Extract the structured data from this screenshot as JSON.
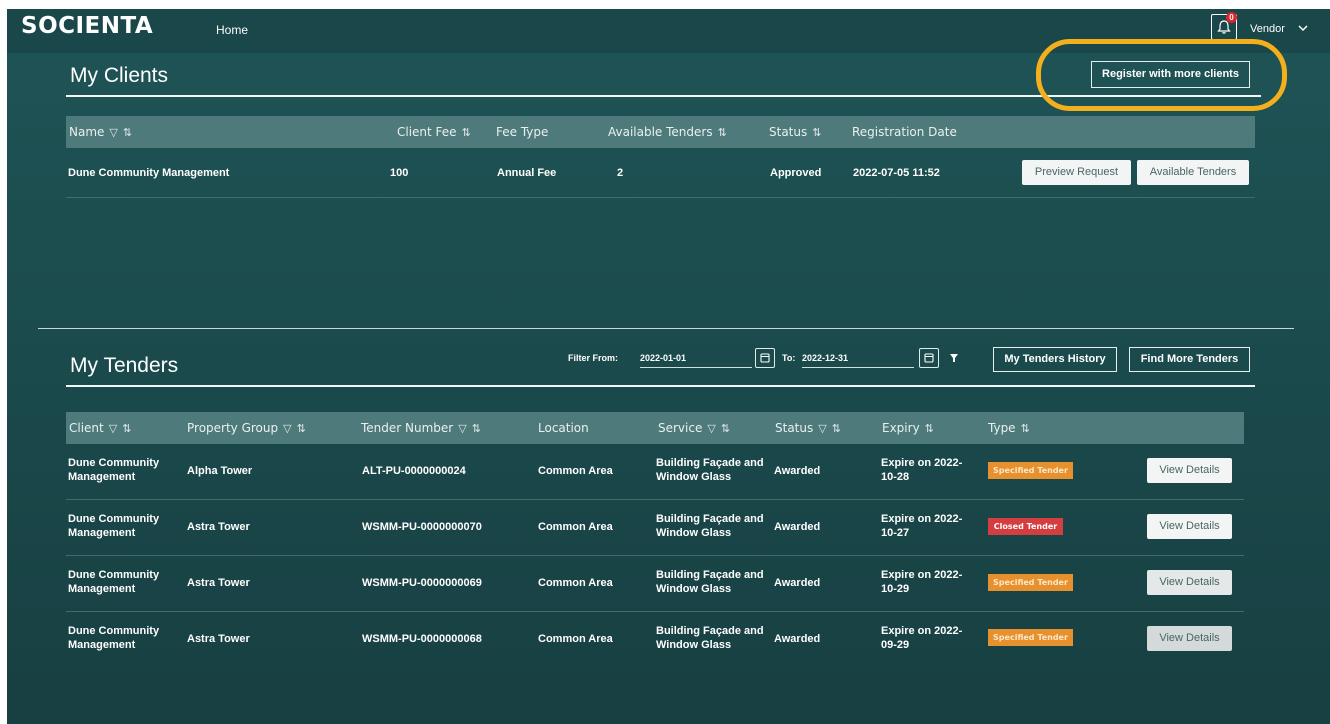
{
  "header": {
    "logo": "SOCIENTA",
    "nav_home": "Home",
    "notification_count": "0",
    "user_label": "Vendor"
  },
  "clients": {
    "title": "My Clients",
    "register_button": "Register with more clients",
    "columns": [
      "Name",
      "Client Fee",
      "Fee Type",
      "Available Tenders",
      "Status",
      "Registration Date"
    ],
    "rows": [
      {
        "name": "Dune Community Management",
        "fee": "100",
        "fee_type": "Annual Fee",
        "available_tenders": "2",
        "status": "Approved",
        "registration_date": "2022-07-05 11:52",
        "preview_button": "Preview Request",
        "tenders_button": "Available Tenders"
      }
    ]
  },
  "tenders": {
    "title": "My Tenders",
    "filter_from_label": "Filter From:",
    "filter_from_value": "2022-01-01",
    "filter_to_label": "To:",
    "filter_to_value": "2022-12-31",
    "history_button": "My Tenders History",
    "find_button": "Find More Tenders",
    "columns": [
      "Client",
      "Property Group",
      "Tender Number",
      "Location",
      "Service",
      "Status",
      "Expiry",
      "Type"
    ],
    "rows": [
      {
        "client_1": "Dune Community",
        "client_2": "Management",
        "property_group": "Alpha Tower",
        "tender_number": "ALT-PU-0000000024",
        "location": "Common Area",
        "service_1": "Building Façade and",
        "service_2": "Window Glass",
        "status": "Awarded",
        "expiry_1": "Expire on 2022-",
        "expiry_2": "10-28",
        "type": "Specified Tender",
        "type_kind": "specified",
        "action": "View Details"
      },
      {
        "client_1": "Dune Community",
        "client_2": "Management",
        "property_group": "Astra Tower",
        "tender_number": "WSMM-PU-0000000070",
        "location": "Common Area",
        "service_1": "Building Façade and",
        "service_2": "Window Glass",
        "status": "Awarded",
        "expiry_1": "Expire on 2022-",
        "expiry_2": "10-27",
        "type": "Closed Tender",
        "type_kind": "closed",
        "action": "View Details"
      },
      {
        "client_1": "Dune Community",
        "client_2": "Management",
        "property_group": "Astra Tower",
        "tender_number": "WSMM-PU-0000000069",
        "location": "Common Area",
        "service_1": "Building Façade and",
        "service_2": "Window Glass",
        "status": "Awarded",
        "expiry_1": "Expire on 2022-",
        "expiry_2": "10-29",
        "type": "Specified Tender",
        "type_kind": "specified",
        "action": "View Details"
      },
      {
        "client_1": "Dune Community",
        "client_2": "Management",
        "property_group": "Astra Tower",
        "tender_number": "WSMM-PU-0000000068",
        "location": "Common Area",
        "service_1": "Building Façade and",
        "service_2": "Window Glass",
        "status": "Awarded",
        "expiry_1": "Expire on 2022-",
        "expiry_2": "09-29",
        "type": "Specified Tender",
        "type_kind": "specified",
        "action": "View Details"
      }
    ]
  },
  "colors": {
    "background": "#1b4b4d",
    "table_header": "#4f7a7b",
    "specified_badge": "#e6902e",
    "closed_badge": "#d43e40",
    "highlight_ring": "#f3b01c"
  }
}
